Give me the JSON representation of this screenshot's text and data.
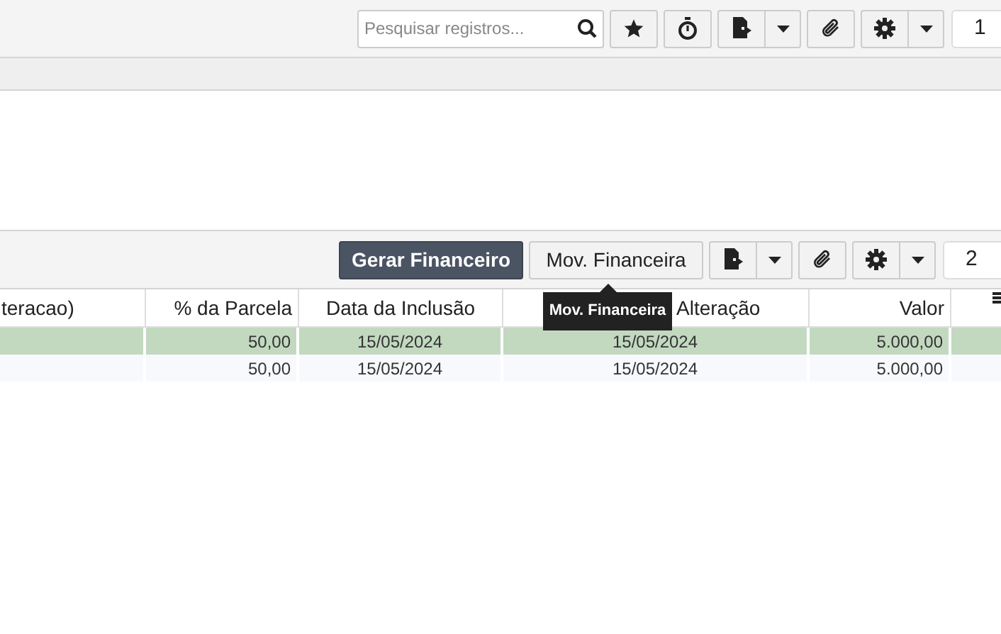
{
  "top_toolbar": {
    "search": {
      "placeholder": "Pesquisar registros..."
    },
    "page": "1"
  },
  "grid_toolbar": {
    "buttons": [
      {
        "label": "Gerar Financeiro",
        "kind": "primary"
      },
      {
        "label": "Mov. Financeira",
        "kind": "default"
      }
    ],
    "page": "2"
  },
  "tooltip": "Mov. Financeira",
  "table": {
    "columns": [
      {
        "label": "teracao)"
      },
      {
        "label": "% da Parcela"
      },
      {
        "label": "Data da Inclusão"
      },
      {
        "label": "Alteração"
      },
      {
        "label": "Valor"
      }
    ],
    "rows": [
      {
        "selected": true,
        "cells": [
          "",
          "50,00",
          "15/05/2024",
          "15/05/2024",
          "5.000,00"
        ]
      },
      {
        "selected": false,
        "cells": [
          "",
          "50,00",
          "15/05/2024",
          "15/05/2024",
          "5.000,00"
        ]
      }
    ]
  }
}
